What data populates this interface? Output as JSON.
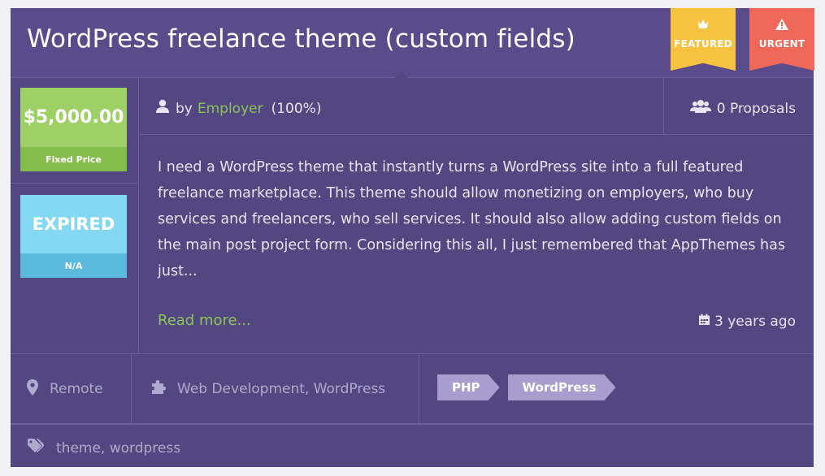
{
  "listing": {
    "title": "WordPress freelance theme (custom fields)",
    "badges": {
      "featured": "FEATURED",
      "urgent": "URGENT"
    },
    "price": {
      "amount": "$5,000.00",
      "type": "Fixed Price"
    },
    "status": {
      "label": "EXPIRED",
      "detail": "N/A"
    },
    "author": {
      "by": "by",
      "name": "Employer",
      "rating": "(100%)"
    },
    "proposals": "0 Proposals",
    "description": "I need a WordPress theme that instantly turns a WordPress site into a full featured freelance marketplace. This theme should allow monetizing on employers, who buy services and freelancers, who sell services. It should also allow adding custom fields on the main post project form. Considering this all, I just remembered that AppThemes has just...",
    "read_more": "Read more...",
    "posted": "3 years ago",
    "location": "Remote",
    "categories": "Web Development, WordPress",
    "skills": [
      "PHP",
      "WordPress"
    ],
    "tags": "theme, wordpress"
  },
  "colors": {
    "card_bg": "#534781",
    "featured": "#f7c23f",
    "urgent": "#f0685a",
    "price_green": "#9ed065",
    "expired_blue": "#85d8f1",
    "link_green": "#8dc35a",
    "skill_tag": "#a79ecf"
  },
  "icons": {
    "featured": "crown-icon",
    "urgent": "warning-icon",
    "author": "user-icon",
    "proposals": "users-icon",
    "posted": "calendar-icon",
    "location": "map-pin-icon",
    "category": "puzzle-icon",
    "tags": "tags-icon"
  }
}
